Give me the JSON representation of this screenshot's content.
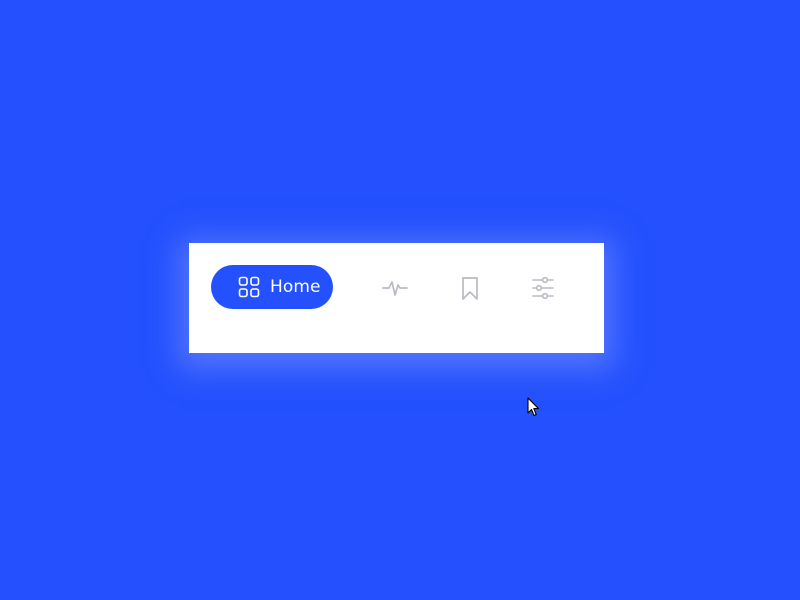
{
  "colors": {
    "background": "#2451fd",
    "accent": "#2451fd",
    "bar_background": "#ffffff",
    "inactive_icon": "#b8bbc2",
    "active_text": "#ffffff"
  },
  "tab_bar": {
    "active_tab": "home",
    "tabs": [
      {
        "id": "home",
        "label": "Home",
        "icon": "grid-icon",
        "active": true
      },
      {
        "id": "activity",
        "label": "",
        "icon": "activity-icon",
        "active": false
      },
      {
        "id": "bookmarks",
        "label": "",
        "icon": "bookmark-icon",
        "active": false
      },
      {
        "id": "settings",
        "label": "",
        "icon": "sliders-icon",
        "active": false
      }
    ]
  },
  "cursor": {
    "icon": "mouse-pointer-icon"
  }
}
